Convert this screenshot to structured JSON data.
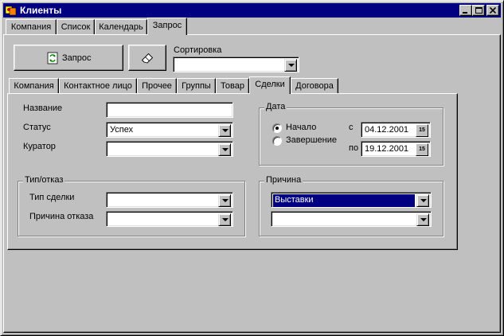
{
  "window": {
    "title": "Клиенты",
    "icons": {
      "app": "app-icon",
      "minimize": "minimize-icon",
      "maximize": "maximize-icon",
      "close": "close-icon"
    }
  },
  "top_tabs": [
    {
      "label": "Компания"
    },
    {
      "label": "Список"
    },
    {
      "label": "Календарь"
    },
    {
      "label": "Запрос",
      "active": true
    }
  ],
  "toolbar": {
    "query_button": "Запрос",
    "query_icon": "refresh-icon",
    "clear_icon": "eraser-icon",
    "sort_label": "Сортировка",
    "sort_value": ""
  },
  "inner_tabs": [
    {
      "label": "Компания"
    },
    {
      "label": "Контактное лицо"
    },
    {
      "label": "Прочее"
    },
    {
      "label": "Группы"
    },
    {
      "label": "Товар"
    },
    {
      "label": "Сделки",
      "active": true
    },
    {
      "label": "Договора"
    }
  ],
  "deal_form": {
    "name_label": "Название",
    "name_value": "",
    "status_label": "Статус",
    "status_value": "Успех",
    "curator_label": "Куратор",
    "curator_value": ""
  },
  "date_group": {
    "title": "Дата",
    "start_label": "Начало",
    "end_label": "Завершение",
    "start_selected": true,
    "from_label": "с",
    "from_value": "04.12.2001",
    "to_label": "по",
    "to_value": "19.12.2001",
    "calendar_icon": "calendar-icon",
    "calendar_glyph": "15"
  },
  "type_group": {
    "title": "Тип/отказ",
    "deal_type_label": "Тип сделки",
    "deal_type_value": "",
    "refusal_reason_label": "Причина отказа",
    "refusal_reason_value": ""
  },
  "reason_group": {
    "title": "Причина",
    "reason1_value": "Выставки",
    "reason2_value": ""
  },
  "colors": {
    "face": "#c0c0c0",
    "titlebar": "#000080",
    "selection": "#000080"
  }
}
